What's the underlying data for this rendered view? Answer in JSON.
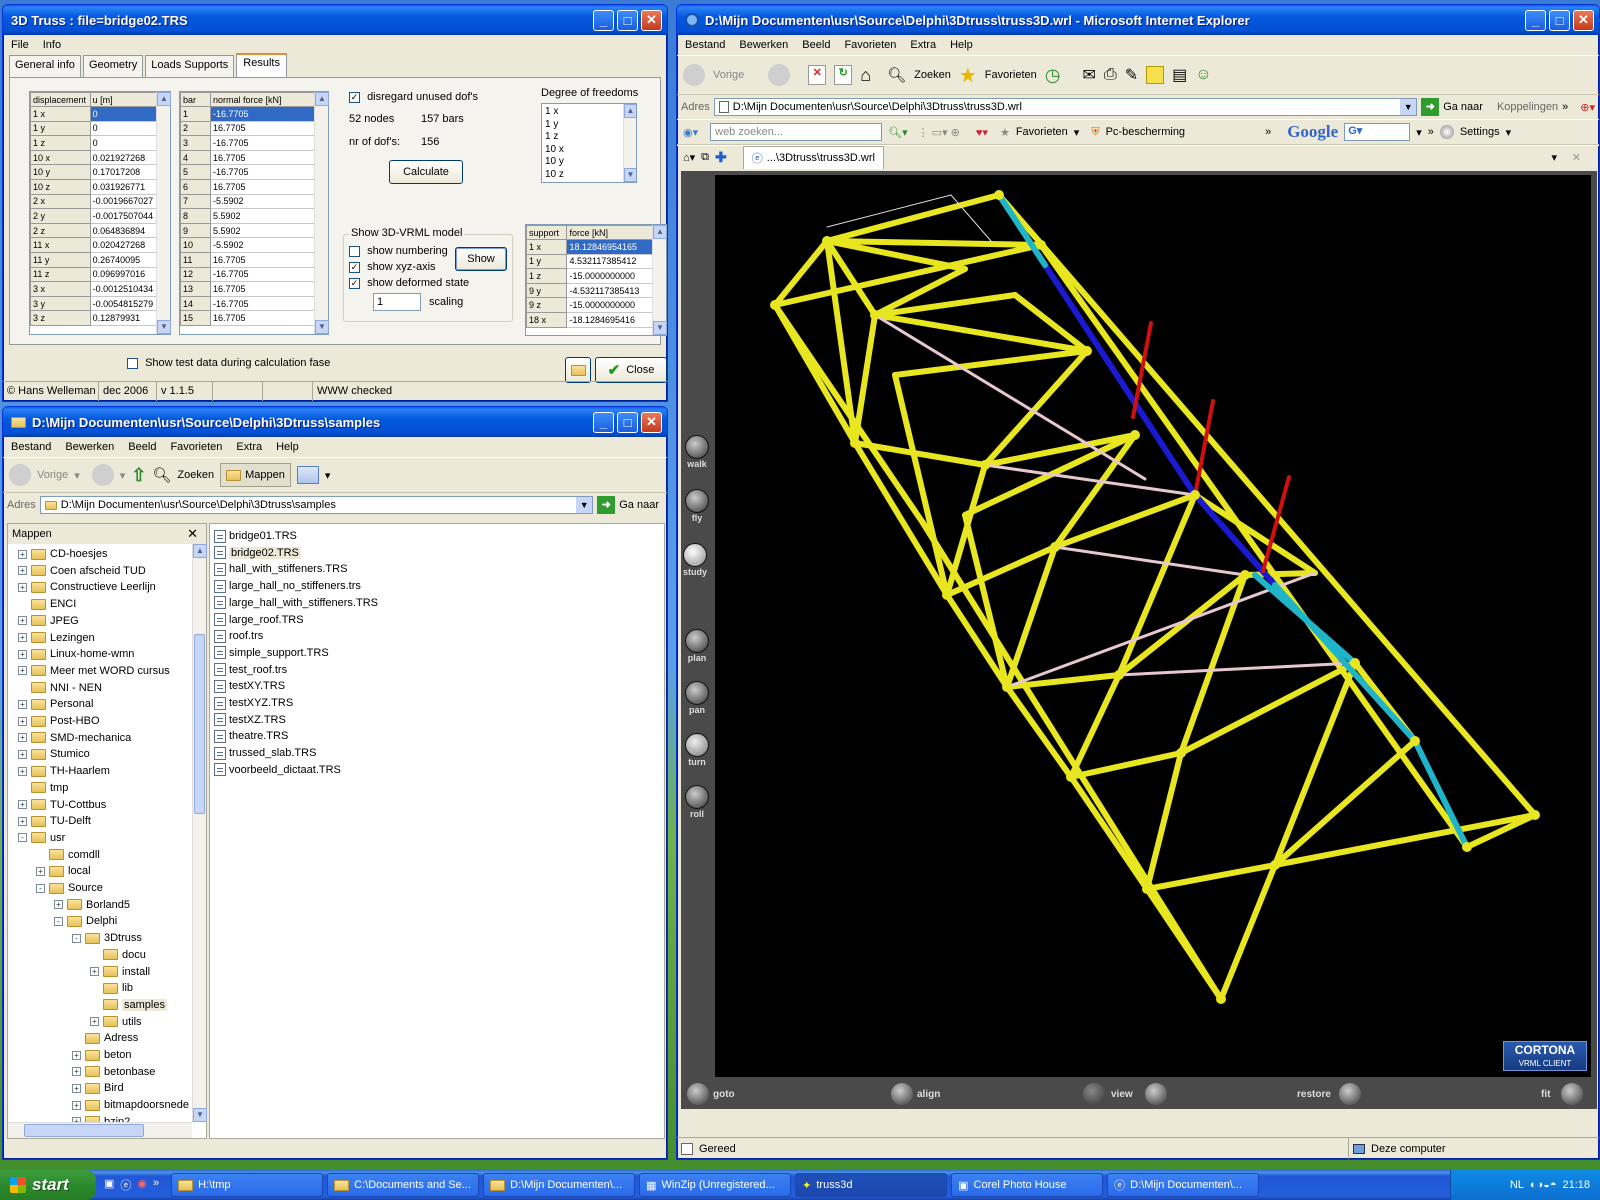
{
  "truss_window": {
    "title": "3D Truss : file=bridge02.TRS",
    "menu": [
      "File",
      "Info"
    ],
    "tabs": [
      "General info",
      "Geometry",
      "Loads Supports",
      "Results"
    ],
    "displacement_table": {
      "headers": [
        "displacement",
        "u [m]"
      ],
      "rows": [
        [
          "1 x",
          "0"
        ],
        [
          "1 y",
          "0"
        ],
        [
          "1 z",
          "0"
        ],
        [
          "10 x",
          "0.021927268"
        ],
        [
          "10 y",
          "0.17017208"
        ],
        [
          "10 z",
          "0.031926771"
        ],
        [
          "2 x",
          "-0.0019667027"
        ],
        [
          "2 y",
          "-0.0017507044"
        ],
        [
          "2 z",
          "0.064836894"
        ],
        [
          "11 x",
          "0.020427268"
        ],
        [
          "11 y",
          "0.26740095"
        ],
        [
          "11 z",
          "0.096997016"
        ],
        [
          "3 x",
          "-0.0012510434"
        ],
        [
          "3 y",
          "-0.0054815279"
        ],
        [
          "3 z",
          "0.12879931"
        ]
      ]
    },
    "bar_table": {
      "headers": [
        "bar",
        "normal force [kN]"
      ],
      "rows": [
        [
          "1",
          "-16.7705"
        ],
        [
          "2",
          "16.7705"
        ],
        [
          "3",
          "-16.7705"
        ],
        [
          "4",
          "16.7705"
        ],
        [
          "5",
          "-16.7705"
        ],
        [
          "6",
          "16.7705"
        ],
        [
          "7",
          "-5.5902"
        ],
        [
          "8",
          "5.5902"
        ],
        [
          "9",
          "5.5902"
        ],
        [
          "10",
          "-5.5902"
        ],
        [
          "11",
          "16.7705"
        ],
        [
          "12",
          "-16.7705"
        ],
        [
          "13",
          "16.7705"
        ],
        [
          "14",
          "-16.7705"
        ],
        [
          "15",
          "16.7705"
        ]
      ]
    },
    "disregard_label": "disregard unused dof's",
    "nodes_label": "52 nodes",
    "bars_label": "157 bars",
    "dofs_label": "nr of dof's:",
    "dofs_value": "156",
    "calculate_label": "Calculate",
    "dof_group_label": "Degree of freedoms",
    "dof_list": [
      "1 x",
      "1 y",
      "1 z",
      "10 x",
      "10 y",
      "10 z"
    ],
    "vrml_group_label": "Show 3D-VRML model",
    "show_numbering": "show numbering",
    "show_axis": "show xyz-axis",
    "show_deformed": "show deformed state",
    "show_label": "Show",
    "scaling_value": "1",
    "scaling_label": "scaling",
    "support_table": {
      "headers": [
        "support",
        "force [kN]"
      ],
      "rows": [
        [
          "1 x",
          "18.12846954165"
        ],
        [
          "1 y",
          "4.532117385412"
        ],
        [
          "1 z",
          "-15.0000000000"
        ],
        [
          "9 y",
          "-4.532117385413"
        ],
        [
          "9 z",
          "-15.0000000000"
        ],
        [
          "18 x",
          "-18.1284695416"
        ]
      ]
    },
    "test_data_label": "Show test data during calculation fase",
    "close_label": "Close",
    "status": [
      "© Hans Welleman",
      "dec 2006",
      "v 1.1.5",
      "",
      "",
      "WWW checked"
    ]
  },
  "explorer_window": {
    "title": "D:\\Mijn Documenten\\usr\\Source\\Delphi\\3Dtruss\\samples",
    "menu": [
      "Bestand",
      "Bewerken",
      "Beeld",
      "Favorieten",
      "Extra",
      "Help"
    ],
    "back_label": "Vorige",
    "search_label": "Zoeken",
    "folders_label": "Mappen",
    "address_label": "Adres",
    "address_value": "D:\\Mijn Documenten\\usr\\Source\\Delphi\\3Dtruss\\samples",
    "go_label": "Ga naar",
    "folder_pane_title": "Mappen",
    "tree": [
      {
        "label": "CD-hoesjes",
        "level": 0,
        "exp": "+"
      },
      {
        "label": "Coen afscheid TUD",
        "level": 0,
        "exp": "+"
      },
      {
        "label": "Constructieve Leerlijn",
        "level": 0,
        "exp": "+"
      },
      {
        "label": "ENCI",
        "level": 0,
        "exp": ""
      },
      {
        "label": "JPEG",
        "level": 0,
        "exp": "+"
      },
      {
        "label": "Lezingen",
        "level": 0,
        "exp": "+"
      },
      {
        "label": "Linux-home-wmn",
        "level": 0,
        "exp": "+"
      },
      {
        "label": "Meer met WORD cursus",
        "level": 0,
        "exp": "+"
      },
      {
        "label": "NNI - NEN",
        "level": 0,
        "exp": ""
      },
      {
        "label": "Personal",
        "level": 0,
        "exp": "+"
      },
      {
        "label": "Post-HBO",
        "level": 0,
        "exp": "+"
      },
      {
        "label": "SMD-mechanica",
        "level": 0,
        "exp": "+"
      },
      {
        "label": "Stumico",
        "level": 0,
        "exp": "+"
      },
      {
        "label": "TH-Haarlem",
        "level": 0,
        "exp": "+"
      },
      {
        "label": "tmp",
        "level": 0,
        "exp": ""
      },
      {
        "label": "TU-Cottbus",
        "level": 0,
        "exp": "+"
      },
      {
        "label": "TU-Delft",
        "level": 0,
        "exp": "+"
      },
      {
        "label": "usr",
        "level": 0,
        "exp": "-"
      },
      {
        "label": "comdll",
        "level": 1,
        "exp": ""
      },
      {
        "label": "local",
        "level": 1,
        "exp": "+"
      },
      {
        "label": "Source",
        "level": 1,
        "exp": "-"
      },
      {
        "label": "Borland5",
        "level": 2,
        "exp": "+"
      },
      {
        "label": "Delphi",
        "level": 2,
        "exp": "-"
      },
      {
        "label": "3Dtruss",
        "level": 3,
        "exp": "-"
      },
      {
        "label": "docu",
        "level": 4,
        "exp": ""
      },
      {
        "label": "install",
        "level": 4,
        "exp": "+"
      },
      {
        "label": "lib",
        "level": 4,
        "exp": ""
      },
      {
        "label": "samples",
        "level": 4,
        "exp": "",
        "selected": true
      },
      {
        "label": "utils",
        "level": 4,
        "exp": "+"
      },
      {
        "label": "Adress",
        "level": 3,
        "exp": ""
      },
      {
        "label": "beton",
        "level": 3,
        "exp": "+"
      },
      {
        "label": "betonbase",
        "level": 3,
        "exp": "+"
      },
      {
        "label": "Bird",
        "level": 3,
        "exp": "+"
      },
      {
        "label": "bitmapdoorsnede",
        "level": 3,
        "exp": "+"
      },
      {
        "label": "bzip2",
        "level": 3,
        "exp": "+"
      }
    ],
    "files": [
      "bridge01.TRS",
      "bridge02.TRS",
      "hall_with_stiffeners.TRS",
      "large_hall_no_stiffeners.trs",
      "large_hall_with_stiffeners.TRS",
      "large_roof.TRS",
      "roof.trs",
      "simple_support.TRS",
      "test_roof.trs",
      "testXY.TRS",
      "testXYZ.TRS",
      "testXZ.TRS",
      "theatre.TRS",
      "trussed_slab.TRS",
      "voorbeeld_dictaat.TRS"
    ]
  },
  "ie_window": {
    "title": "D:\\Mijn Documenten\\usr\\Source\\Delphi\\3Dtruss\\truss3D.wrl - Microsoft Internet Explorer",
    "menu": [
      "Bestand",
      "Bewerken",
      "Beeld",
      "Favorieten",
      "Extra",
      "Help"
    ],
    "back_label": "Vorige",
    "search_label": "Zoeken",
    "favorites_label": "Favorieten",
    "address_label": "Adres",
    "address_value": "D:\\Mijn Documenten\\usr\\Source\\Delphi\\3Dtruss\\truss3D.wrl",
    "go_label": "Ga naar",
    "links_label": "Koppelingen",
    "web_search_placeholder": "web zoeken...",
    "favorites2_label": "Favorieten",
    "protection_label": "Pc-bescherming",
    "google_label": "Google",
    "settings_label": "Settings",
    "tab_label": "...\\3Dtruss\\truss3D.wrl",
    "nav_left": [
      "walk",
      "fly",
      "study",
      "plan",
      "pan",
      "turn",
      "roll"
    ],
    "nav_bottom": [
      "goto",
      "align",
      "view",
      "restore",
      "fit"
    ],
    "cortona_label": "CORTONA",
    "cortona_sub": "VRML CLIENT",
    "status_left": "Gereed",
    "status_right": "Deze computer"
  },
  "taskbar": {
    "start_label": "start",
    "items": [
      "H:\\tmp",
      "C:\\Documents and Se...",
      "D:\\Mijn Documenten\\...",
      "WinZip (Unregistered...",
      "truss3d",
      "Corel Photo House",
      "D:\\Mijn Documenten\\..."
    ],
    "lang": "NL",
    "clock": "21:18"
  },
  "colors": {
    "truss_yellow": "#e8e620",
    "deformed_blue": "#1a1ad0",
    "deformed_cyan": "#1fb4c8",
    "load_red": "#d01010"
  }
}
